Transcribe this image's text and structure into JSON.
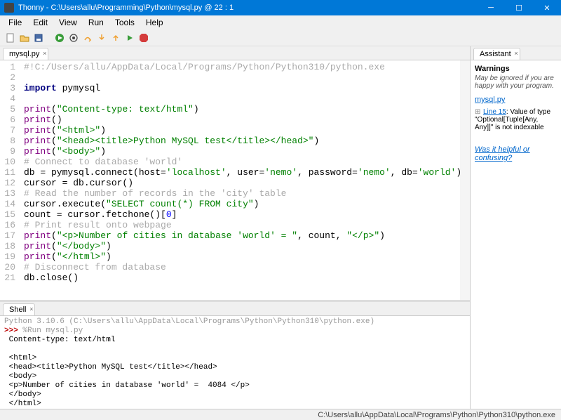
{
  "window": {
    "title": "Thonny  -  C:\\Users\\allu\\Programming\\Python\\mysql.py  @  22 : 1"
  },
  "menu": [
    "File",
    "Edit",
    "View",
    "Run",
    "Tools",
    "Help"
  ],
  "editor": {
    "tab": "mysql.py",
    "lines": [
      {
        "n": "1",
        "html": "<span class=\"c-comment\">#!C:/Users/allu/AppData/Local/Programs/Python/Python310/python.exe</span>"
      },
      {
        "n": "2",
        "html": ""
      },
      {
        "n": "3",
        "html": "<span class=\"c-keyword\">import</span> pymysql"
      },
      {
        "n": "4",
        "html": ""
      },
      {
        "n": "5",
        "html": "<span class=\"c-builtin\">print</span>(<span class=\"c-string\">\"Content-type: text/html\"</span>)"
      },
      {
        "n": "6",
        "html": "<span class=\"c-builtin\">print</span>()"
      },
      {
        "n": "7",
        "html": "<span class=\"c-builtin\">print</span>(<span class=\"c-string\">\"&lt;html&gt;\"</span>)"
      },
      {
        "n": "8",
        "html": "<span class=\"c-builtin\">print</span>(<span class=\"c-string\">\"&lt;head&gt;&lt;title&gt;Python MySQL test&lt;/title&gt;&lt;/head&gt;\"</span>)"
      },
      {
        "n": "9",
        "html": "<span class=\"c-builtin\">print</span>(<span class=\"c-string\">\"&lt;body&gt;\"</span>)"
      },
      {
        "n": "10",
        "html": "<span class=\"c-comment\"># Connect to database 'world'</span>"
      },
      {
        "n": "11",
        "html": "db = pymysql.connect(host=<span class=\"c-string\">'localhost'</span>, user=<span class=\"c-string\">'nemo'</span>, password=<span class=\"c-string\">'nemo'</span>, db=<span class=\"c-string\">'world'</span>)"
      },
      {
        "n": "12",
        "html": "cursor = db.cursor()"
      },
      {
        "n": "13",
        "html": "<span class=\"c-comment\"># Read the number of records in the 'city' table</span>"
      },
      {
        "n": "14",
        "html": "cursor.execute(<span class=\"c-string\">\"SELECT count(*) FROM city\"</span>)"
      },
      {
        "n": "15",
        "html": "count = cursor.fetchone()[<span class=\"c-number\">0</span>]"
      },
      {
        "n": "16",
        "html": "<span class=\"c-comment\"># Print result onto webpage</span>"
      },
      {
        "n": "17",
        "html": "<span class=\"c-builtin\">print</span>(<span class=\"c-string\">\"&lt;p&gt;Number of cities in database 'world' = \"</span>, count, <span class=\"c-string\">\"&lt;/p&gt;\"</span>)"
      },
      {
        "n": "18",
        "html": "<span class=\"c-builtin\">print</span>(<span class=\"c-string\">\"&lt;/body&gt;\"</span>)"
      },
      {
        "n": "19",
        "html": "<span class=\"c-builtin\">print</span>(<span class=\"c-string\">\"&lt;/html&gt;\"</span>)"
      },
      {
        "n": "20",
        "html": "<span class=\"c-comment\"># Disconnect from database</span>"
      },
      {
        "n": "21",
        "html": "db.close()"
      }
    ]
  },
  "shell": {
    "tab": "Shell",
    "header": "Python 3.10.6 (C:\\Users\\allu\\AppData\\Local\\Programs\\Python\\Python310\\python.exe)",
    "prompt": ">>>",
    "cmd": "%Run mysql.py",
    "output": " Content-type: text/html\n\n <html>\n <head><title>Python MySQL test</title></head>\n <body>\n <p>Number of cities in database 'world' =  4084 </p>\n </body>\n </html>"
  },
  "assistant": {
    "tab": "Assistant",
    "heading": "Warnings",
    "sub": "May be ignored if you are happy with your program.",
    "filelink": "mysql.py",
    "warn_line": "Line 15",
    "warn_text": ": Value of type \"Optional[Tuple[Any, Any]]\" is not indexable",
    "feedback": "Was it helpful or confusing?"
  },
  "status": "C:\\Users\\allu\\AppData\\Local\\Programs\\Python\\Python310\\python.exe"
}
